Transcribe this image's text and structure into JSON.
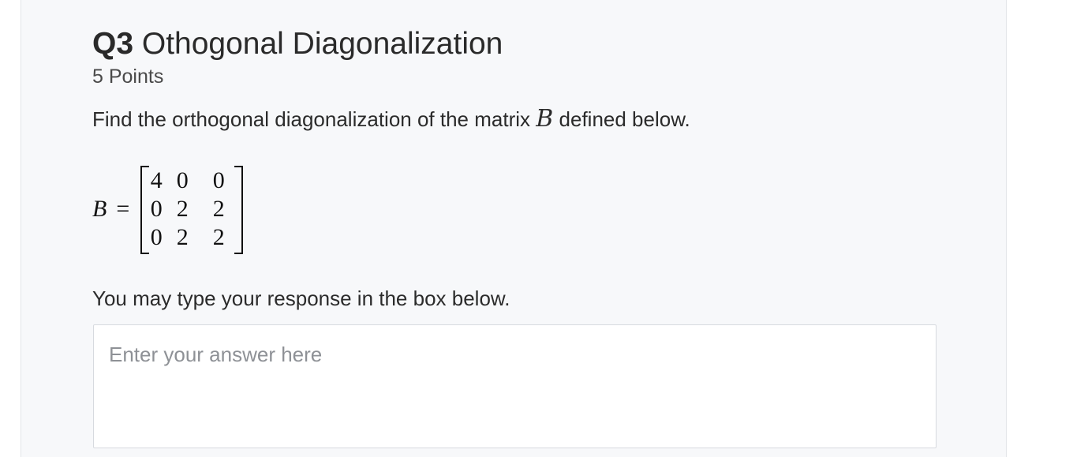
{
  "question": {
    "number": "Q3",
    "title": "Othogonal Diagonalization",
    "points": "5 Points"
  },
  "prompt": {
    "before": "Find the orthogonal diagonalization of the matrix ",
    "variable": "B",
    "after": " defined below."
  },
  "equation": {
    "lhs": "B",
    "sign": "=",
    "matrix": [
      [
        "4",
        "0",
        "0"
      ],
      [
        "0",
        "2",
        "2"
      ],
      [
        "0",
        "2",
        "2"
      ]
    ]
  },
  "instruction": "You may type your response in the box below.",
  "answer": {
    "value": "",
    "placeholder": "Enter your answer here"
  }
}
